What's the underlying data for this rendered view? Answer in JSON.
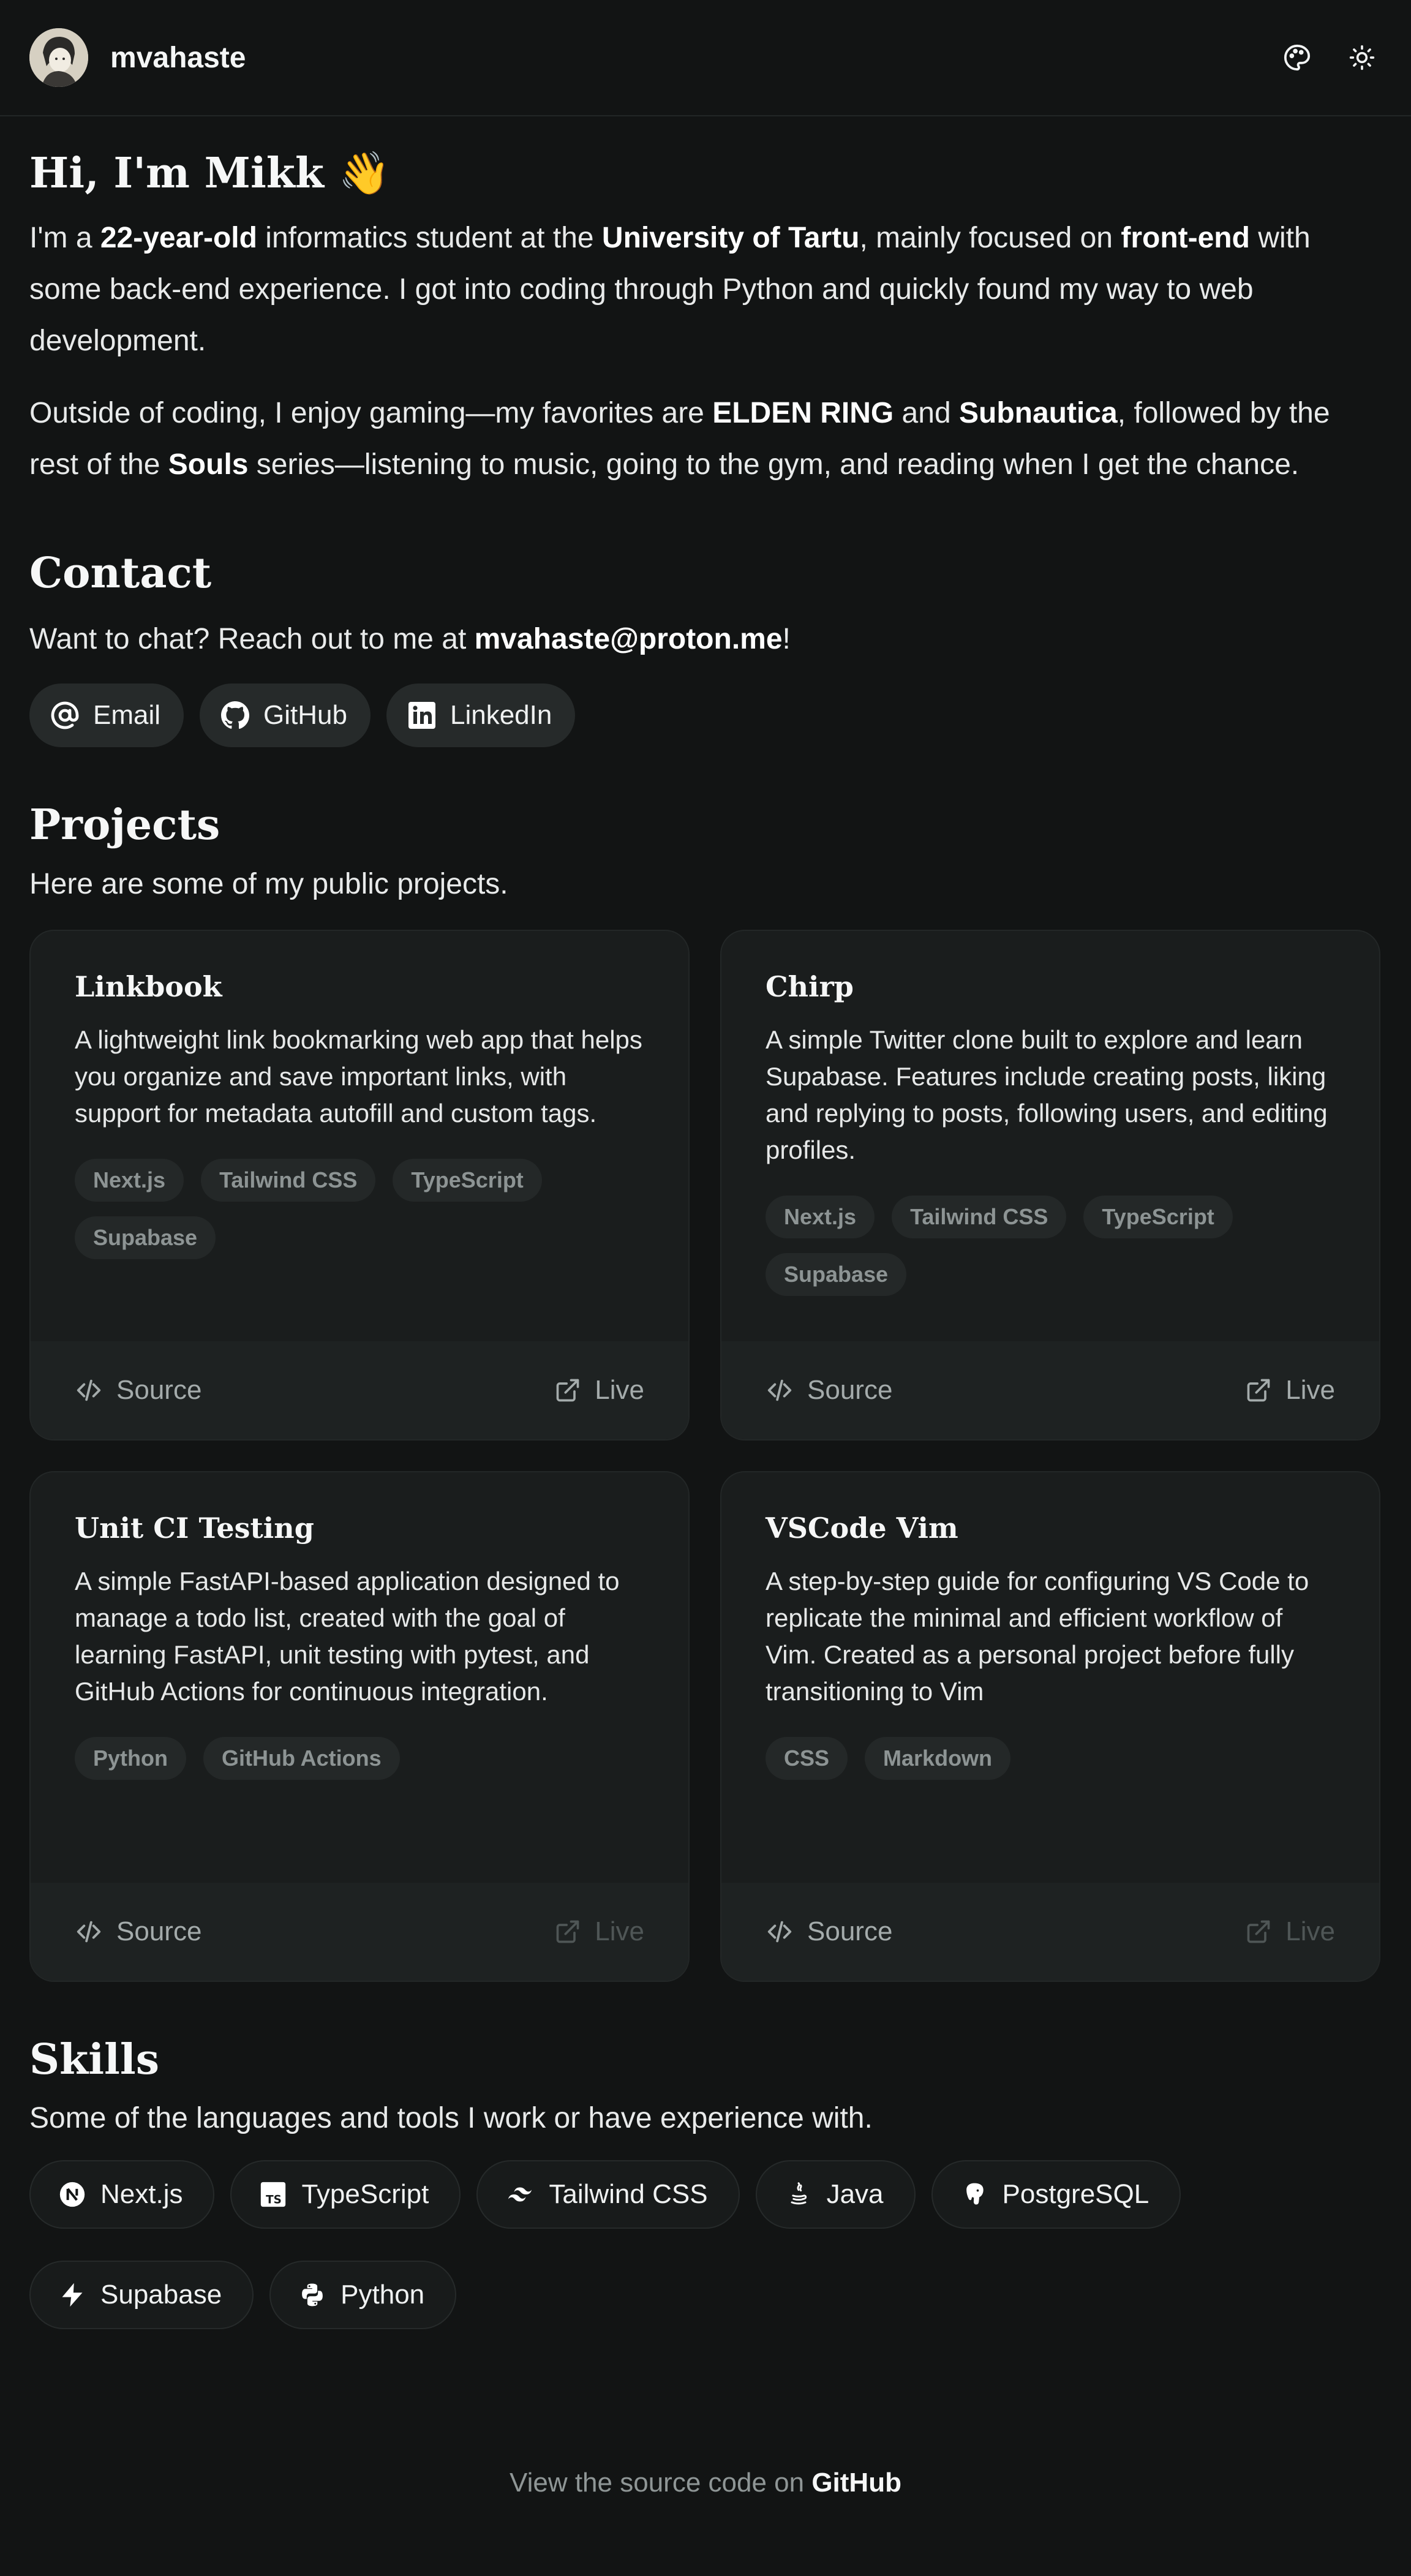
{
  "header": {
    "site_name": "mvahaste",
    "theme_button_icon": "palette-icon",
    "mode_button_icon": "sun-icon"
  },
  "intro": {
    "heading": "Hi, I'm Mikk 👋",
    "p1": [
      "I'm a ",
      "22-year-old",
      " informatics student at the ",
      "University of Tartu",
      ", mainly focused on ",
      "front-end",
      " with some back-end experience. I got into coding through Python and quickly found my way to web development."
    ],
    "p2": [
      "Outside of coding, I enjoy gaming—my favorites are ",
      "ELDEN RING",
      " and ",
      "Subnautica",
      ", followed by the rest of the ",
      "Souls",
      " series—listening to music, going to the gym, and reading when I get the chance."
    ]
  },
  "contact": {
    "heading": "Contact",
    "text_before": "Want to chat? Reach out to me at ",
    "email": "mvahaste@proton.me",
    "text_after": "!",
    "buttons": [
      {
        "label": "Email",
        "icon": "at-sign-icon"
      },
      {
        "label": "GitHub",
        "icon": "github-icon"
      },
      {
        "label": "LinkedIn",
        "icon": "linkedin-icon"
      }
    ]
  },
  "projects": {
    "heading": "Projects",
    "subtitle": "Here are some of my public projects.",
    "source_label": "Source",
    "live_label": "Live",
    "items": [
      {
        "title": "Linkbook",
        "desc": "A lightweight link bookmarking web app that helps you organize and save important links, with support for metadata autofill and custom tags.",
        "tags": [
          "Next.js",
          "Tailwind CSS",
          "TypeScript",
          "Supabase"
        ],
        "live_enabled": true
      },
      {
        "title": "Chirp",
        "desc": "A simple Twitter clone built to explore and learn Supabase. Features include creating posts, liking and replying to posts, following users, and editing profiles.",
        "tags": [
          "Next.js",
          "Tailwind CSS",
          "TypeScript",
          "Supabase"
        ],
        "live_enabled": true
      },
      {
        "title": "Unit CI Testing",
        "desc": "A simple FastAPI-based application designed to manage a todo list, created with the goal of learning FastAPI, unit testing with pytest, and GitHub Actions for continuous integration.",
        "tags": [
          "Python",
          "GitHub Actions"
        ],
        "live_enabled": false
      },
      {
        "title": "VSCode Vim",
        "desc": "A step-by-step guide for configuring VS Code to replicate the minimal and efficient workflow of Vim. Created as a personal project before fully transitioning to Vim",
        "tags": [
          "CSS",
          "Markdown"
        ],
        "live_enabled": false
      }
    ]
  },
  "skills": {
    "heading": "Skills",
    "subtitle": "Some of the languages and tools I work or have experience with.",
    "items": [
      {
        "label": "Next.js",
        "icon": "nextjs-icon"
      },
      {
        "label": "TypeScript",
        "icon": "typescript-icon"
      },
      {
        "label": "Tailwind CSS",
        "icon": "tailwind-icon"
      },
      {
        "label": "Java",
        "icon": "java-icon"
      },
      {
        "label": "PostgreSQL",
        "icon": "postgresql-icon"
      },
      {
        "label": "Supabase",
        "icon": "supabase-icon"
      },
      {
        "label": "Python",
        "icon": "python-icon"
      }
    ]
  },
  "footer": {
    "text": "View the source code on ",
    "link": "GitHub"
  },
  "colors": {
    "background": "#121414",
    "card": "#1a1d1d",
    "chip": "#262a2a",
    "text": "#eceeee",
    "muted": "#8f9696"
  }
}
